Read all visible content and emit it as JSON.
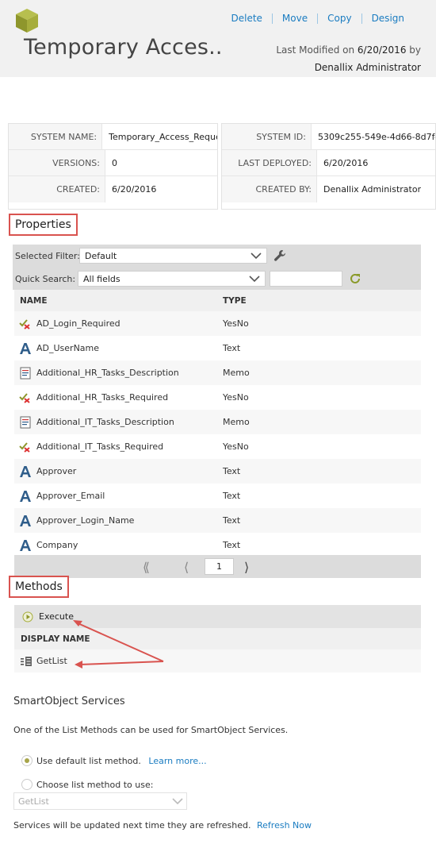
{
  "header": {
    "title": "Temporary Acces..",
    "actions": [
      "Delete",
      "Move",
      "Copy",
      "Design"
    ],
    "modified_prefix": "Last Modified on",
    "modified_date": "6/20/2016",
    "modified_by_word": "by",
    "modified_by": "Denallix Administrator"
  },
  "info_left": [
    {
      "label": "SYSTEM NAME:",
      "value": "Temporary_Access_Reque"
    },
    {
      "label": "VERSIONS:",
      "value": "0"
    },
    {
      "label": "CREATED:",
      "value": "6/20/2016"
    }
  ],
  "info_right": [
    {
      "label": "SYSTEM ID:",
      "value": "5309c255-549e-4d66-8d7f-9"
    },
    {
      "label": "LAST DEPLOYED:",
      "value": "6/20/2016"
    },
    {
      "label": "CREATED BY:",
      "value": "Denallix Administrator"
    }
  ],
  "properties": {
    "title": "Properties",
    "selected_filter_label": "Selected Filter:",
    "selected_filter_value": "Default",
    "quick_search_label": "Quick Search:",
    "quick_search_value": "All fields",
    "columns": [
      "NAME",
      "TYPE"
    ],
    "rows": [
      {
        "name": "AD_Login_Required",
        "type": "YesNo",
        "icon": "yesno-icon"
      },
      {
        "name": "AD_UserName",
        "type": "Text",
        "icon": "text-icon"
      },
      {
        "name": "Additional_HR_Tasks_Description",
        "type": "Memo",
        "icon": "memo-icon"
      },
      {
        "name": "Additional_HR_Tasks_Required",
        "type": "YesNo",
        "icon": "yesno-icon"
      },
      {
        "name": "Additional_IT_Tasks_Description",
        "type": "Memo",
        "icon": "memo-icon"
      },
      {
        "name": "Additional_IT_Tasks_Required",
        "type": "YesNo",
        "icon": "yesno-icon"
      },
      {
        "name": "Approver",
        "type": "Text",
        "icon": "text-icon"
      },
      {
        "name": "Approver_Email",
        "type": "Text",
        "icon": "text-icon"
      },
      {
        "name": "Approver_Login_Name",
        "type": "Text",
        "icon": "text-icon"
      },
      {
        "name": "Company",
        "type": "Text",
        "icon": "text-icon"
      }
    ],
    "page": "1"
  },
  "methods": {
    "title": "Methods",
    "execute_label": "Execute",
    "column": "DISPLAY NAME",
    "rows": [
      {
        "name": "GetList",
        "icon": "list-method-icon"
      }
    ]
  },
  "services": {
    "title": "SmartObject Services",
    "description": "One of the List Methods can be used for SmartObject Services.",
    "option_default": "Use default list method.",
    "learn_more": "Learn more...",
    "option_choose": "Choose list method to use:",
    "choose_value": "GetList",
    "footer_text": "Services will be updated next time they are refreshed.",
    "refresh_link": "Refresh Now"
  },
  "colors": {
    "accent": "#1a7cc1",
    "highlight_box": "#d9534f",
    "logo": "#9aa534"
  }
}
